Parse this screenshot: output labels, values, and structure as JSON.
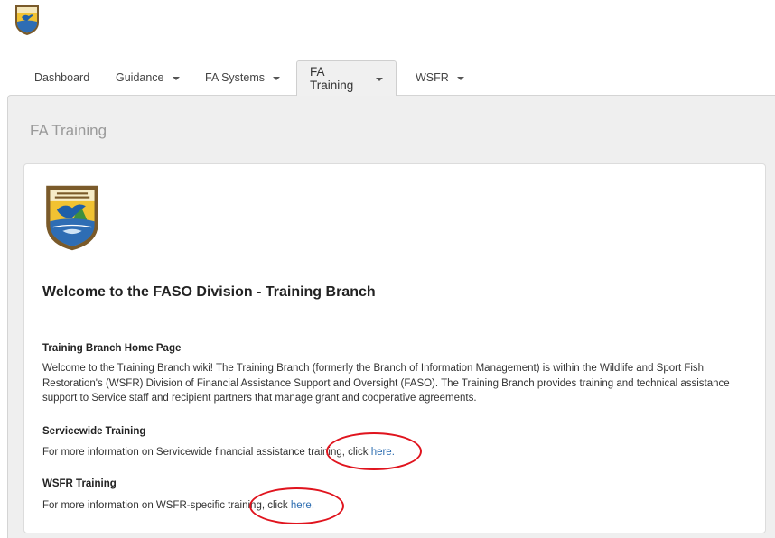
{
  "logo": {
    "label": "U.S. Fish & Wildlife Service"
  },
  "nav": {
    "tabs": [
      {
        "label": "Dashboard",
        "dropdown": false,
        "active": false
      },
      {
        "label": "Guidance",
        "dropdown": true,
        "active": false
      },
      {
        "label": "FA Systems",
        "dropdown": true,
        "active": false
      },
      {
        "label": "FA Training",
        "dropdown": true,
        "active": true
      },
      {
        "label": "WSFR",
        "dropdown": true,
        "active": false
      }
    ]
  },
  "page": {
    "title": "FA Training"
  },
  "content": {
    "welcome": "Welcome to the FASO Division - Training Branch",
    "home": {
      "heading": "Training Branch Home Page",
      "body": "Welcome to the Training Branch wiki! The Training Branch (formerly the Branch of Information Management) is within the Wildlife and Sport Fish Restoration's (WSFR) Division of Financial Assistance Support and Oversight (FASO). The Training Branch provides training and technical assistance support to Service staff and recipient partners that manage grant and cooperative agreements."
    },
    "servicewide": {
      "heading": "Servicewide Training",
      "text": "For more information on Servicewide financial assistance training, click ",
      "link": "here."
    },
    "wsfr": {
      "heading": "WSFR Training",
      "text": "For more information on WSFR-specific training, click ",
      "link": "here."
    }
  },
  "colors": {
    "annotation": "#e0141e",
    "link": "#2b6cb0",
    "panel": "#efefef"
  }
}
